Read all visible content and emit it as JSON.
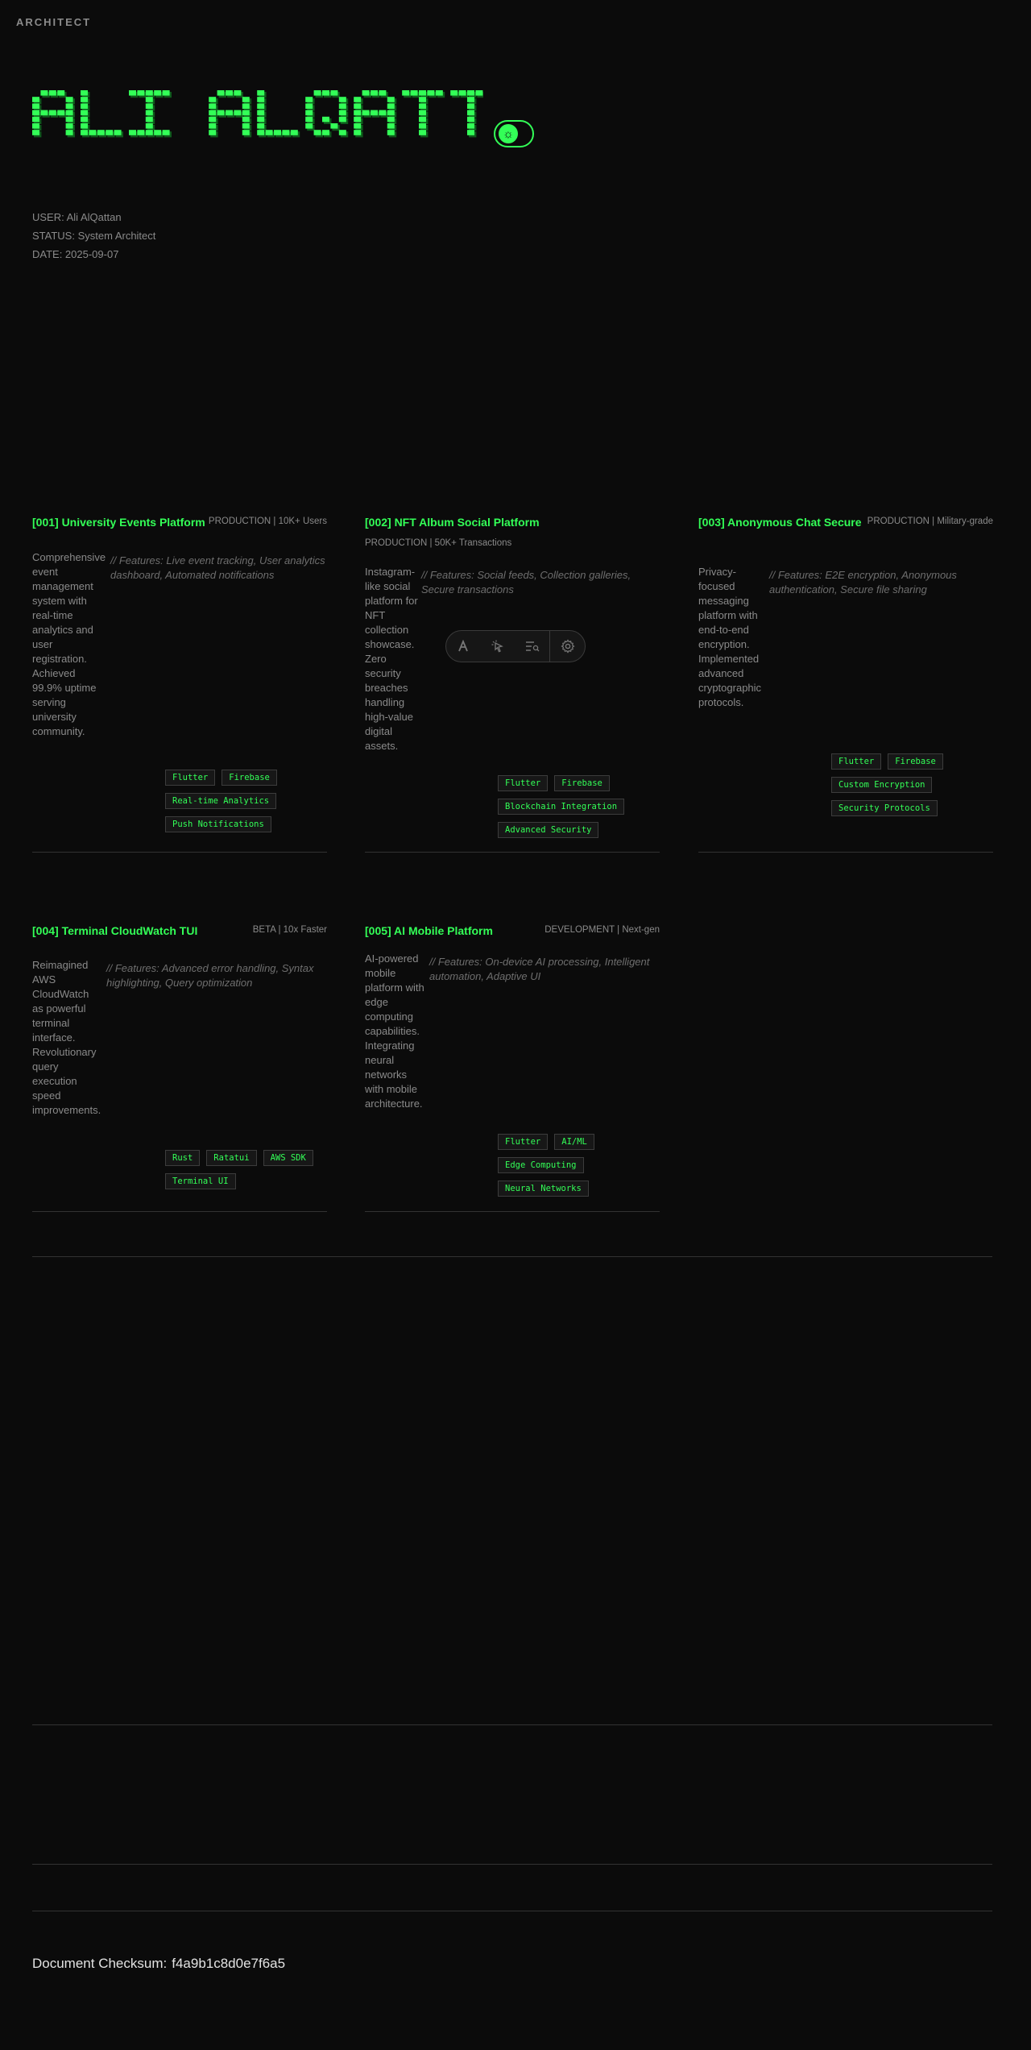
{
  "brand": "ARCHITECT",
  "hero": {
    "title": "ALI ALQATTAN",
    "accent_color": "#33ff57"
  },
  "meta": {
    "user": "USER: Ali AlQattan",
    "status": "STATUS: System Architect",
    "date": "DATE: 2025-09-07"
  },
  "projects": [
    {
      "title": "[001] University Events Platform",
      "status": "PRODUCTION | 10K+ Users",
      "description": "Comprehensive event management system with real-time analytics and user registration. Achieved 99.9% uptime serving university community.",
      "features": "// Features: Live event tracking, User analytics dashboard, Automated notifications",
      "tags": [
        "Flutter",
        "Firebase",
        "Real-time Analytics",
        "Push Notifications"
      ]
    },
    {
      "title": "[002] NFT Album Social Platform",
      "status": "PRODUCTION | 50K+ Transactions",
      "description": "Instagram-like social platform for NFT collection showcase. Zero security breaches handling high-value digital assets.",
      "features": "// Features: Social feeds, Collection galleries, Secure transactions",
      "tags": [
        "Flutter",
        "Firebase",
        "Blockchain Integration",
        "Advanced Security"
      ]
    },
    {
      "title": "[003] Anonymous Chat Secure",
      "status": "PRODUCTION | Military-grade",
      "description": "Privacy-focused messaging platform with end-to-end encryption. Implemented advanced cryptographic protocols.",
      "features": "// Features: E2E encryption, Anonymous authentication, Secure file sharing",
      "tags": [
        "Flutter",
        "Firebase",
        "Custom Encryption",
        "Security Protocols"
      ]
    },
    {
      "title": "[004] Terminal CloudWatch TUI",
      "status": "BETA | 10x Faster",
      "description": "Reimagined AWS CloudWatch as powerful terminal interface. Revolutionary query execution speed improvements.",
      "features": "// Features: Advanced error handling, Syntax highlighting, Query optimization",
      "tags": [
        "Rust",
        "Ratatui",
        "AWS SDK",
        "Terminal UI"
      ]
    },
    {
      "title": "[005] AI Mobile Platform",
      "status": "DEVELOPMENT | Next-gen",
      "description": "AI-powered mobile platform with edge computing capabilities. Integrating neural networks with mobile architecture.",
      "features": "// Features: On-device AI processing, Intelligent automation, Adaptive UI",
      "tags": [
        "Flutter",
        "AI/ML",
        "Edge Computing",
        "Neural Networks"
      ]
    }
  ],
  "toolbar": {
    "icons": [
      "logo-icon",
      "cursor-select-icon",
      "inspect-list-icon",
      "settings-gear-icon"
    ]
  },
  "footer": {
    "checksum_label": "Document Checksum:",
    "checksum_value": "f4a9b1c8d0e7f6a5"
  }
}
